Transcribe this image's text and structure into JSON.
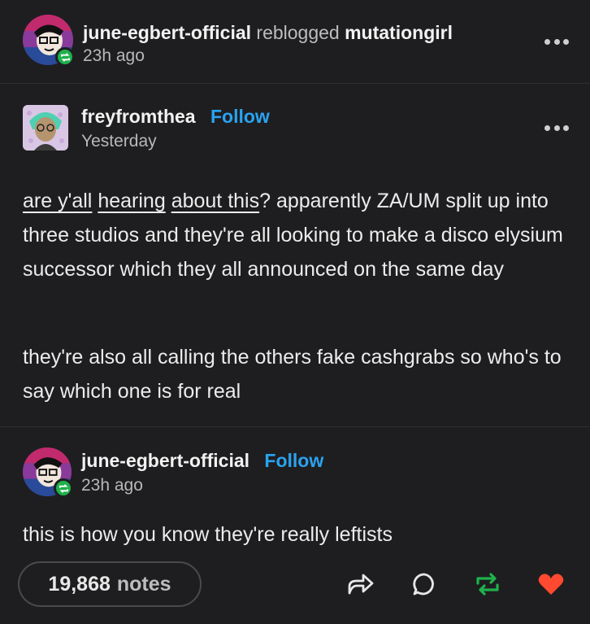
{
  "header": {
    "reblogger": "june-egbert-official",
    "reblogged_word": "reblogged",
    "source": "mutationgirl",
    "time": "23h ago",
    "more_icon": "more-dots-icon"
  },
  "original_post": {
    "username": "freyfromthea",
    "follow_label": "Follow",
    "time": "Yesterday",
    "paragraph1": {
      "link1": "are y'all",
      "link2": "hearing",
      "link3": "about this",
      "rest": "? apparently ZA/UM split up into three studios and they're all looking to make a disco elysium successor which they all announced on the same day"
    },
    "paragraph2": "they're also all calling the others fake cashgrabs so who's to say which one is for real"
  },
  "reblog": {
    "username": "june-egbert-official",
    "follow_label": "Follow",
    "time": "23h ago",
    "text": "this is how you know they're really leftists"
  },
  "footer": {
    "notes_count": "19,868",
    "notes_label": "notes",
    "icons": [
      "share-icon",
      "reply-icon",
      "reblog-icon",
      "like-icon"
    ]
  },
  "colors": {
    "background": "#1e1e20",
    "accent_blue": "#2aa3f0",
    "reblog_green": "#1fb14b",
    "like_red": "#ff4930"
  }
}
